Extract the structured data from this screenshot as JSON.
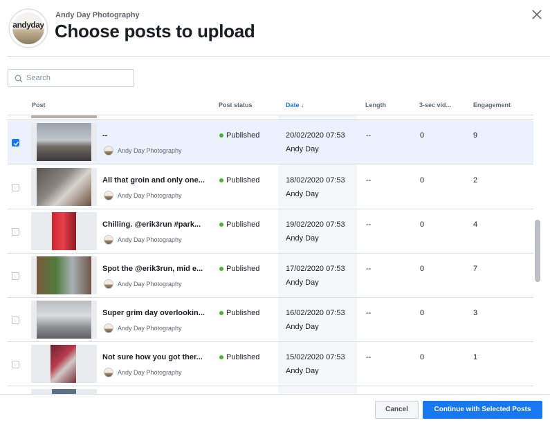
{
  "header": {
    "page_name": "Andy Day Photography",
    "title": "Choose posts to upload",
    "avatar_logo_text": "andyday"
  },
  "search": {
    "placeholder": "Search",
    "value": ""
  },
  "table": {
    "columns": [
      "Post",
      "Post status",
      "Date",
      "Length",
      "3-sec vid...",
      "Engagement"
    ],
    "sort_indicator": "↓",
    "rows": [
      {
        "selected": true,
        "title": "--",
        "author": "Andy Day Photography",
        "status": "Published",
        "date": "20/02/2020 07:53",
        "by": "Andy Day",
        "length": "--",
        "views": "0",
        "engagement": "9"
      },
      {
        "selected": false,
        "title": "All that groin and only one...",
        "author": "Andy Day Photography",
        "status": "Published",
        "date": "18/02/2020 07:53",
        "by": "Andy Day",
        "length": "--",
        "views": "0",
        "engagement": "2"
      },
      {
        "selected": false,
        "title": "Chilling. @erik3run #park...",
        "author": "Andy Day Photography",
        "status": "Published",
        "date": "19/02/2020 07:53",
        "by": "Andy Day",
        "length": "--",
        "views": "0",
        "engagement": "4"
      },
      {
        "selected": false,
        "title": "Spot the @erik3run, mid e...",
        "author": "Andy Day Photography",
        "status": "Published",
        "date": "17/02/2020 07:53",
        "by": "Andy Day",
        "length": "--",
        "views": "0",
        "engagement": "7"
      },
      {
        "selected": false,
        "title": "Super grim day overlookin...",
        "author": "Andy Day Photography",
        "status": "Published",
        "date": "16/02/2020 07:53",
        "by": "Andy Day",
        "length": "--",
        "views": "0",
        "engagement": "3"
      },
      {
        "selected": false,
        "title": "Not sure how you got ther...",
        "author": "Andy Day Photography",
        "status": "Published",
        "date": "15/02/2020 07:53",
        "by": "Andy Day",
        "length": "--",
        "views": "0",
        "engagement": "1"
      }
    ]
  },
  "footer": {
    "cancel_label": "Cancel",
    "continue_label": "Continue with Selected Posts"
  },
  "colors": {
    "accent": "#1877f2",
    "status_published": "#42b72a",
    "selected_row": "#ebf2fd"
  }
}
